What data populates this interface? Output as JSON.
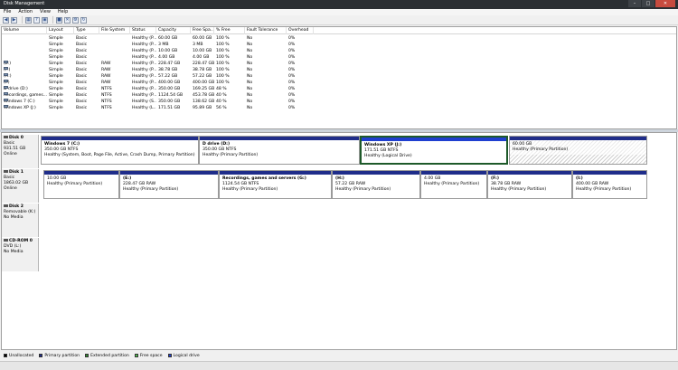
{
  "window": {
    "title": "Disk Management"
  },
  "menu": [
    "File",
    "Action",
    "View",
    "Help"
  ],
  "volume_table": {
    "columns": [
      "Volume",
      "Layout",
      "Type",
      "File System",
      "Status",
      "Capacity",
      "Free Spa...",
      "% Free",
      "Fault Tolerance",
      "Overhead"
    ],
    "rows": [
      [
        "",
        "Simple",
        "Basic",
        "",
        "Healthy (P...",
        "60.00 GB",
        "60.00 GB",
        "100 %",
        "No",
        "0%"
      ],
      [
        "",
        "Simple",
        "Basic",
        "",
        "Healthy (P...",
        "3 MB",
        "3 MB",
        "100 %",
        "No",
        "0%"
      ],
      [
        "",
        "Simple",
        "Basic",
        "",
        "Healthy (P...",
        "10.00 GB",
        "10.00 GB",
        "100 %",
        "No",
        "0%"
      ],
      [
        "",
        "Simple",
        "Basic",
        "",
        "Healthy (P...",
        "4.00 GB",
        "4.00 GB",
        "100 %",
        "No",
        "0%"
      ],
      [
        "(E:)",
        "Simple",
        "Basic",
        "RAW",
        "Healthy (P...",
        "228.47 GB",
        "228.47 GB",
        "100 %",
        "No",
        "0%"
      ],
      [
        "(F:)",
        "Simple",
        "Basic",
        "RAW",
        "Healthy (P...",
        "38.78 GB",
        "38.78 GB",
        "100 %",
        "No",
        "0%"
      ],
      [
        "(H:)",
        "Simple",
        "Basic",
        "RAW",
        "Healthy (P...",
        "57.22 GB",
        "57.22 GB",
        "100 %",
        "No",
        "0%"
      ],
      [
        "(I:)",
        "Simple",
        "Basic",
        "RAW",
        "Healthy (P...",
        "400.00 GB",
        "400.00 GB",
        "100 %",
        "No",
        "0%"
      ],
      [
        "D drive (D:)",
        "Simple",
        "Basic",
        "NTFS",
        "Healthy (P...",
        "350.00 GB",
        "169.25 GB",
        "48 %",
        "No",
        "0%"
      ],
      [
        "Recordings, games...",
        "Simple",
        "Basic",
        "NTFS",
        "Healthy (P...",
        "1124.54 GB",
        "453.78 GB",
        "40 %",
        "No",
        "0%"
      ],
      [
        "Windows 7 (C:)",
        "Simple",
        "Basic",
        "NTFS",
        "Healthy (S...",
        "350.00 GB",
        "138.62 GB",
        "40 %",
        "No",
        "0%"
      ],
      [
        "Windows XP (J:)",
        "Simple",
        "Basic",
        "NTFS",
        "Healthy (L...",
        "171.51 GB",
        "95.89 GB",
        "56 %",
        "No",
        "0%"
      ]
    ]
  },
  "disks": [
    {
      "name": "Disk 0",
      "type": "Basic",
      "size": "931.51 GB",
      "status": "Online",
      "partitions": [
        {
          "name": "Windows 7 (C:)",
          "size": "350.00 GB NTFS",
          "status": "Healthy (System, Boot, Page File, Active, Crash Dump, Primary Partition)"
        },
        {
          "name": "D drive (D:)",
          "size": "350.00 GB NTFS",
          "status": "Healthy (Primary Partition)"
        },
        {
          "name": "Windows XP (J:)",
          "size": "171.51 GB NTFS",
          "status": "Healthy (Logical Drive)"
        },
        {
          "name": "",
          "size": "60.00 GB",
          "status": "Healthy (Primary Partition)"
        }
      ]
    },
    {
      "name": "Disk 1",
      "type": "Basic",
      "size": "1863.02 GB",
      "status": "Online",
      "partitions": [
        {
          "name": "",
          "size": "10.00 GB",
          "status": "Healthy (Primary Partition)"
        },
        {
          "name": "(E:)",
          "size": "228.47 GB RAW",
          "status": "Healthy (Primary Partition)"
        },
        {
          "name": "Recordings, games and servers (G:)",
          "size": "1124.54 GB NTFS",
          "status": "Healthy (Primary Partition)"
        },
        {
          "name": "(H:)",
          "size": "57.22 GB RAW",
          "status": "Healthy (Primary Partition)"
        },
        {
          "name": "",
          "size": "4.00 GB",
          "status": "Healthy (Primary Partition)"
        },
        {
          "name": "(F:)",
          "size": "38.78 GB RAW",
          "status": "Healthy (Primary Partition)"
        },
        {
          "name": "(I:)",
          "size": "400.00 GB RAW",
          "status": "Healthy (Primary Partition)"
        }
      ]
    },
    {
      "name": "Disk 2",
      "type": "Removable (K:)",
      "size": "",
      "status": "No Media"
    },
    {
      "name": "CD-ROM 0",
      "type": "DVD (L:)",
      "size": "",
      "status": "No Media"
    }
  ],
  "legend": [
    {
      "label": "Unallocated",
      "color": "#000000"
    },
    {
      "label": "Primary partition",
      "color": "#1f2d8a"
    },
    {
      "label": "Extended partition",
      "color": "#2e8b2e"
    },
    {
      "label": "Free space",
      "color": "#4cc04c"
    },
    {
      "label": "Logical drive",
      "color": "#1f3fd0"
    }
  ],
  "colors": {
    "primary": "#1f2d8a",
    "logical": "#1f3fd0",
    "extended": "#2e8b2e",
    "selected_border": "#1e5a2a"
  }
}
